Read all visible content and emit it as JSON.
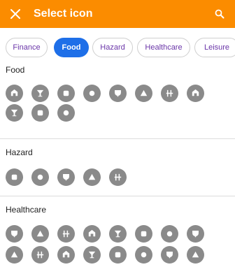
{
  "colors": {
    "accent": "#fb8c00",
    "chip_active": "#1e6fe8",
    "icon_bg": "#8a8a8a",
    "icon_fg": "#ffffff"
  },
  "app_bar": {
    "title": "Select icon",
    "close_icon": "close-icon",
    "search_icon": "search-icon"
  },
  "filter_chips": [
    {
      "label": "Finance",
      "selected": false
    },
    {
      "label": "Food",
      "selected": true
    },
    {
      "label": "Hazard",
      "selected": false
    },
    {
      "label": "Healthcare",
      "selected": false
    },
    {
      "label": "Leisure",
      "selected": false
    }
  ],
  "sections": [
    {
      "title": "Food",
      "icons": [
        "fast-food-icon",
        "cocktail-icon",
        "bbq-icon",
        "beer-icon",
        "coffee-icon",
        "drink-icon",
        "restaurant-icon",
        "ice-cream-icon",
        "cup-icon",
        "cutlery-icon",
        "market-stall-icon"
      ]
    },
    {
      "title": "Hazard",
      "icons": [
        "hazard-triangle-icon",
        "fire-hazard-icon",
        "flood-hazard-icon",
        "radiation-hazard-icon",
        "chemical-hazard-icon"
      ]
    },
    {
      "title": "Healthcare",
      "icons": [
        "ambulance-icon",
        "first-aid-kit-icon",
        "blood-donation-icon",
        "hospital-icon",
        "heart-plus-icon",
        "pharmacy-icon",
        "medical-case-icon",
        "x-ray-icon",
        "clinic-icon",
        "health-house-icon",
        "hospital-building-icon",
        "microscope-icon",
        "nurse-icon",
        "physio-icon",
        "pill-icon",
        "family-icon"
      ]
    }
  ]
}
